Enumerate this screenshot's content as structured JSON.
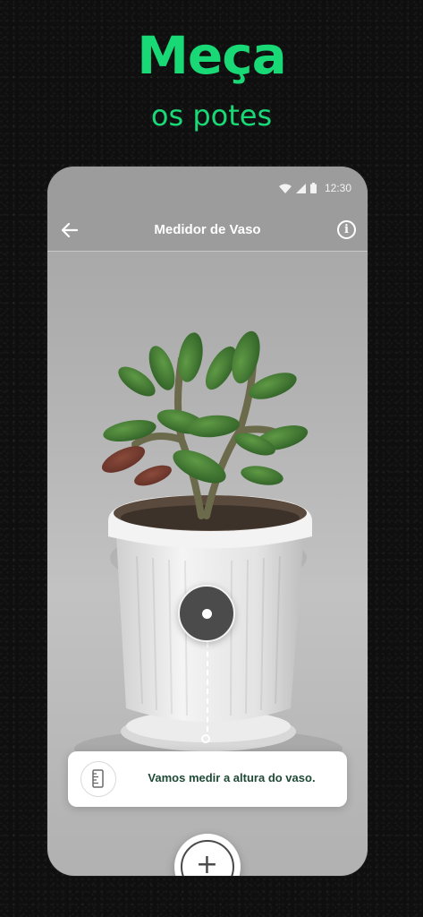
{
  "promo": {
    "headline": "Meça",
    "subline": "os potes"
  },
  "status_bar": {
    "time": "12:30",
    "icons": [
      "wifi-icon",
      "signal-icon",
      "battery-icon"
    ]
  },
  "app_bar": {
    "title": "Medidor de Vaso",
    "back_icon": "arrow-left-icon",
    "info_label": "i"
  },
  "hint": {
    "text": "Vamos medir a altura do vaso.",
    "icon": "ruler-icon"
  },
  "actions": {
    "add_label": "+"
  },
  "colors": {
    "accent": "#19d977",
    "hint_text": "#1f4a35",
    "background": "#0f0f10"
  }
}
